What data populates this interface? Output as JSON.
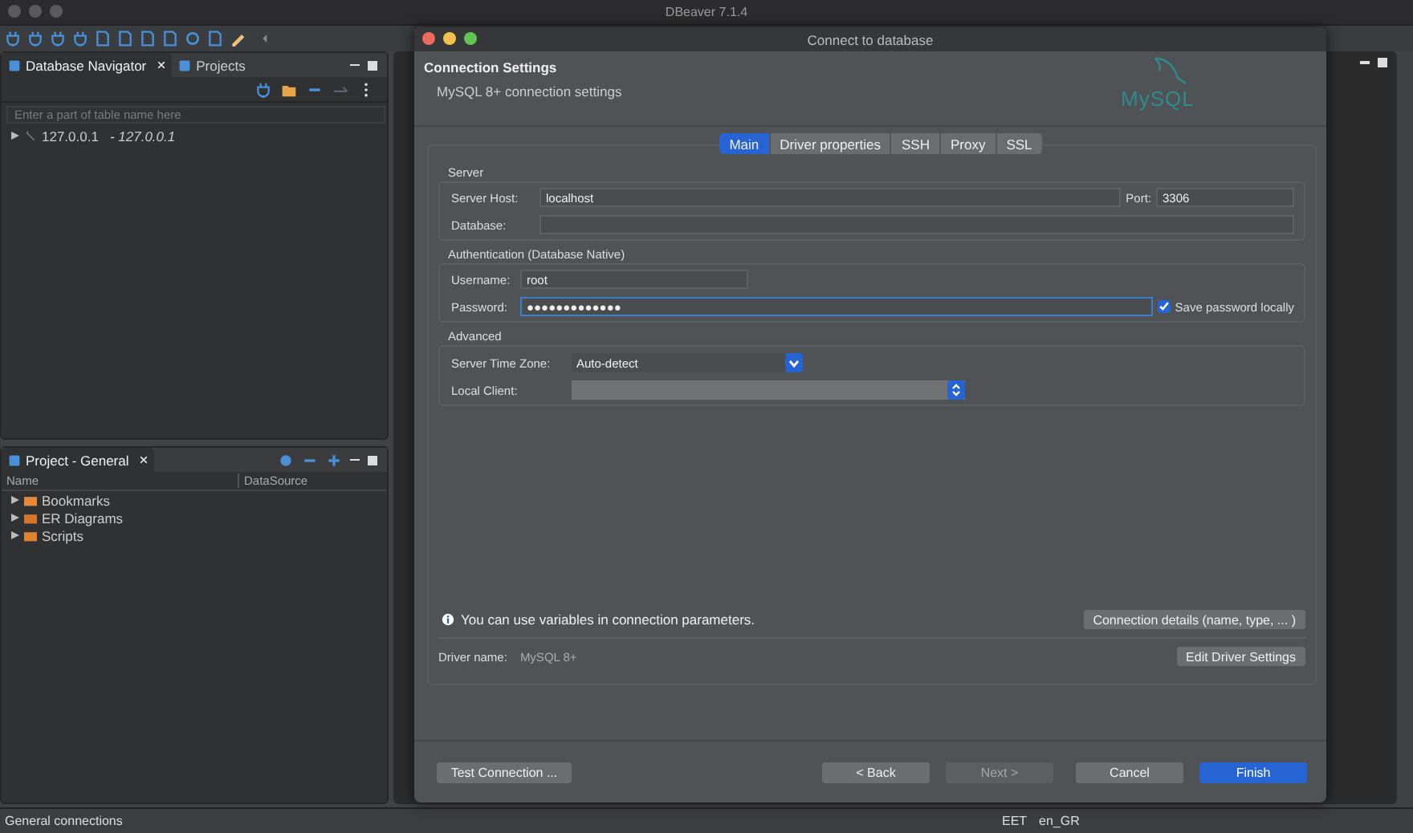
{
  "app": {
    "title": "DBeaver 7.1.4"
  },
  "navigator": {
    "tabs": [
      {
        "label": "Database Navigator",
        "selected": true
      },
      {
        "label": "Projects",
        "selected": false
      }
    ],
    "filter": {
      "placeholder": "Enter a part of table name here"
    },
    "tree": [
      {
        "label": "127.0.0.1",
        "detail": "- 127.0.0.1",
        "expanded": false
      }
    ]
  },
  "project": {
    "tab": "Project - General",
    "columns": [
      "Name",
      "DataSource"
    ],
    "items": [
      {
        "label": "Bookmarks",
        "kind": "bookmarks",
        "expanded": false
      },
      {
        "label": "ER Diagrams",
        "kind": "diagrams",
        "expanded": false
      },
      {
        "label": "Scripts",
        "kind": "scripts",
        "expanded": false
      }
    ]
  },
  "dialog": {
    "title": "Connect to database",
    "heading": "Connection Settings",
    "subtitle": "MySQL 8+ connection settings",
    "logo": "MySQL",
    "tabs": [
      {
        "label": "Main",
        "selected": true
      },
      {
        "label": "Driver properties",
        "selected": false
      },
      {
        "label": "SSH",
        "selected": false
      },
      {
        "label": "Proxy",
        "selected": false
      },
      {
        "label": "SSL",
        "selected": false
      }
    ],
    "server": {
      "title": "Server",
      "host_label": "Server Host:",
      "host": "localhost",
      "port_label": "Port:",
      "port": "3306",
      "database_label": "Database:"
    },
    "auth": {
      "title": "Authentication (Database Native)",
      "username_label": "Username:",
      "username": "root",
      "password_label": "Password:",
      "password": "●●●●●●●●●●●●●",
      "password_focused": true,
      "save_password": {
        "label": "Save password locally",
        "checked": true
      }
    },
    "advanced": {
      "title": "Advanced",
      "timezone_label": "Server Time Zone:",
      "timezone": "Auto-detect",
      "client_label": "Local Client:",
      "client_disabled": true
    },
    "info": "You can use variables in connection parameters.",
    "details_button": "Connection details (name, type, ... )",
    "driver_label": "Driver name:",
    "driver": "MySQL 8+",
    "edit_driver_button": "Edit Driver Settings",
    "buttons": [
      {
        "label": "Test Connection ...",
        "kind": "normal",
        "disabled": false
      },
      {
        "label": "< Back",
        "kind": "normal",
        "disabled": false
      },
      {
        "label": "Next >",
        "kind": "normal",
        "disabled": true
      },
      {
        "label": "Cancel",
        "kind": "normal",
        "disabled": false
      },
      {
        "label": "Finish",
        "kind": "default",
        "disabled": false
      }
    ]
  },
  "status_bar": {
    "text": "General connections",
    "timezone": "EET",
    "locale": "en_GR"
  }
}
